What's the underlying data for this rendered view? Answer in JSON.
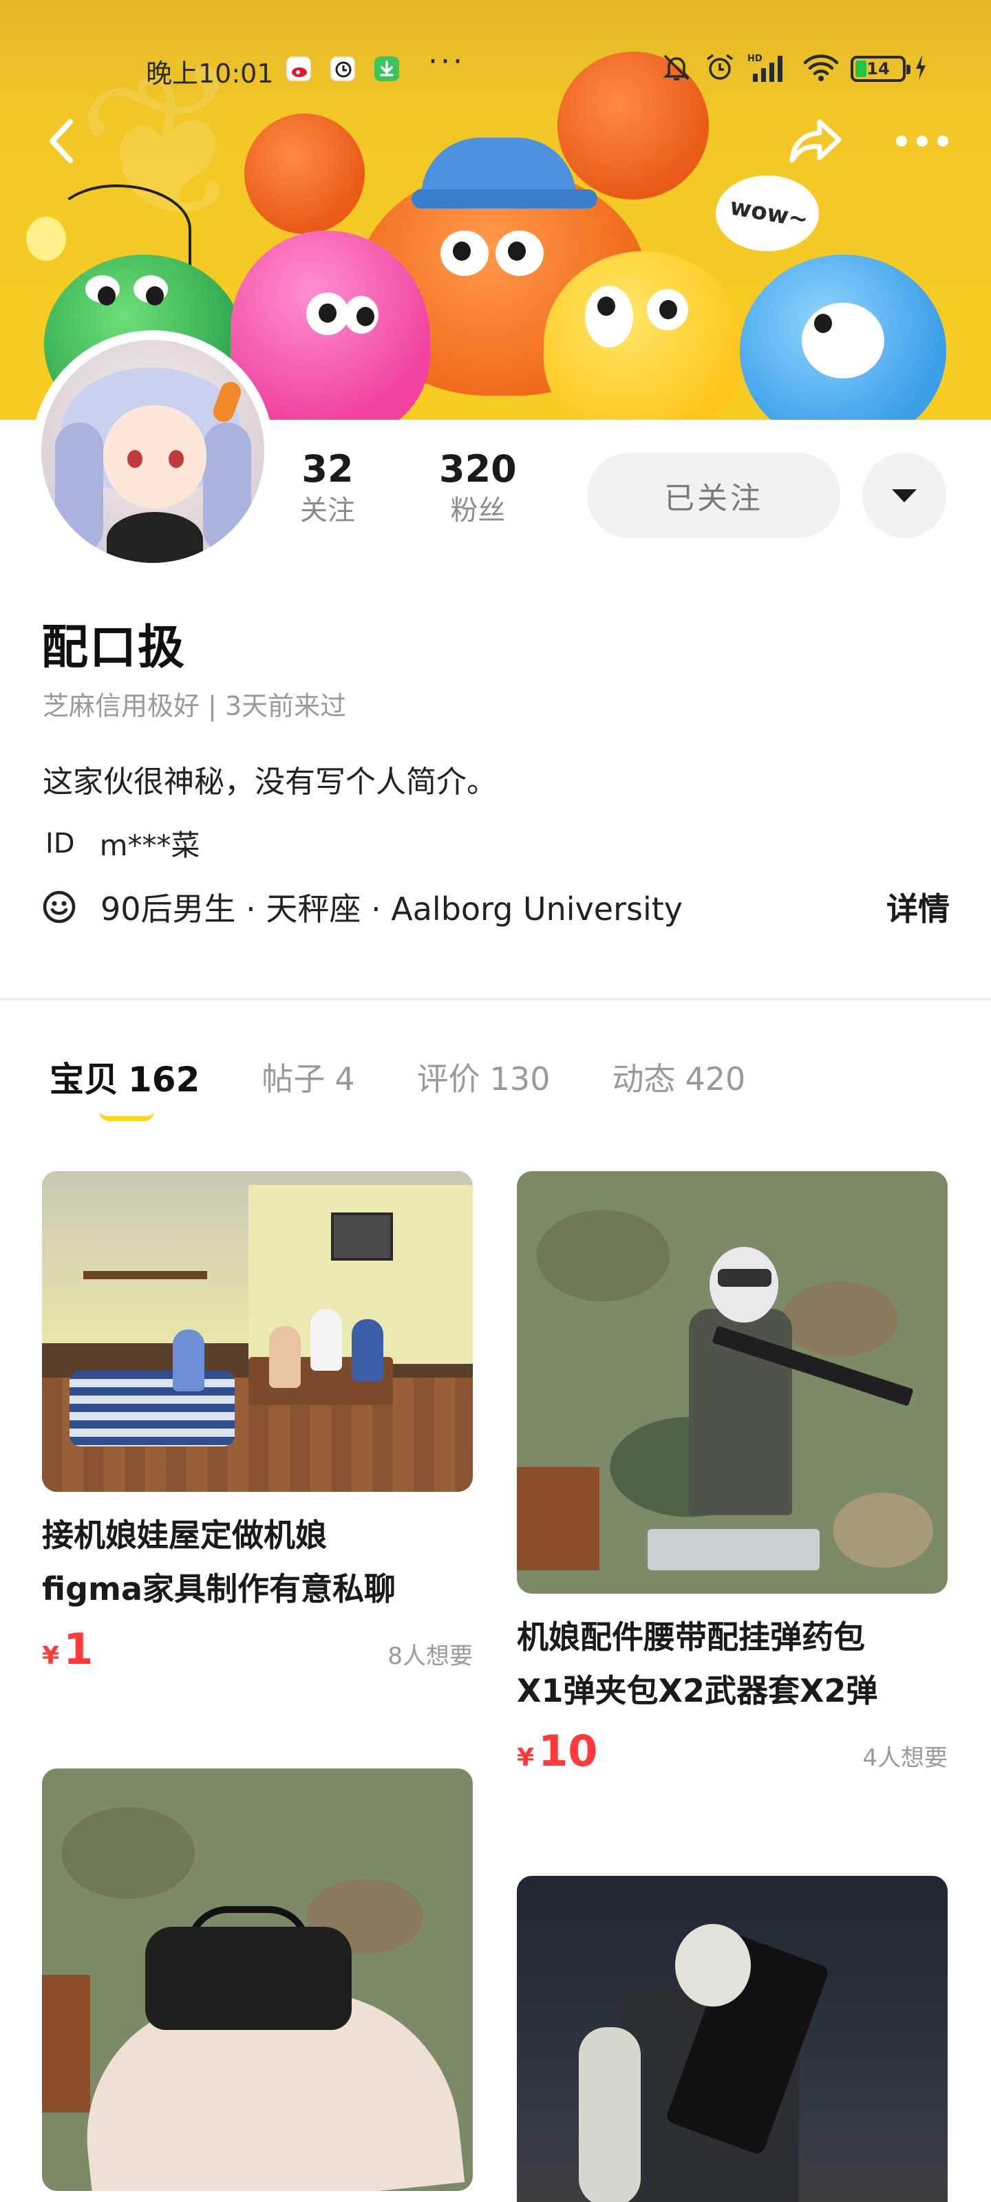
{
  "status_bar": {
    "time": "晚上10:01",
    "more": "···",
    "battery": "14",
    "icons": [
      "weibo-icon",
      "clock-app-icon",
      "download-icon",
      "mute-icon",
      "alarm-icon",
      "hd-signal-icon",
      "wifi-icon",
      "battery-icon",
      "charging-icon"
    ]
  },
  "nav": {
    "back_icon": "chevron-left-icon",
    "share_icon": "share-icon",
    "more_icon": "more-dots-icon"
  },
  "banner": {
    "bubble_text": "wow~"
  },
  "profile": {
    "following_count": "32",
    "following_label": "关注",
    "followers_count": "320",
    "followers_label": "粉丝",
    "follow_button": "已关注",
    "username": "配口扱",
    "credit_line": "芝麻信用极好 | 3天前来过",
    "bio": "这家伙很神秘，没有写个人简介。",
    "id_label": "ID",
    "id_value": "m***菜",
    "info": "90后男生 · 天秤座 · Aalborg University",
    "details_link": "详情"
  },
  "tabs": [
    {
      "label": "宝贝",
      "count": "162",
      "active": true
    },
    {
      "label": "帖子",
      "count": "4",
      "active": false
    },
    {
      "label": "评价",
      "count": "130",
      "active": false
    },
    {
      "label": "动态",
      "count": "420",
      "active": false
    }
  ],
  "colors": {
    "price": "#ff3a3a",
    "tab_indicator": "#ffd616",
    "banner_yellow": "#f8cd23"
  },
  "products": [
    {
      "title_line1": "接机娘娃屋定做机娘",
      "title_line2": "figma家具制作有意私聊",
      "currency": "¥",
      "price": "1",
      "wants": "8人想要"
    },
    {
      "title_line1": "机娘配件腰带配挂弹药包",
      "title_line2": "X1弹夹包X2武器套X2弹",
      "currency": "¥",
      "price": "10",
      "wants": "4人想要"
    }
  ]
}
